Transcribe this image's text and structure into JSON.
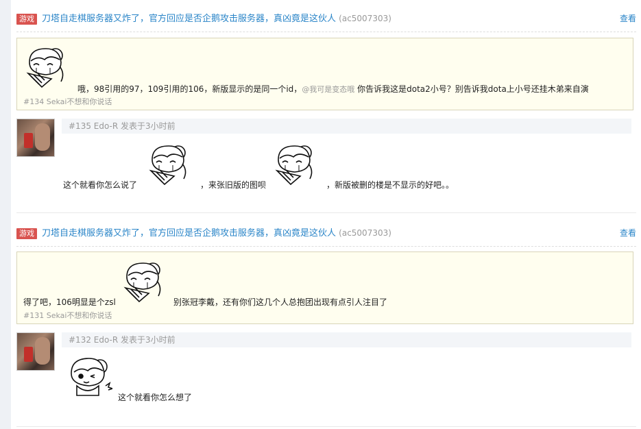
{
  "posts": [
    {
      "tag": "游戏",
      "title": "刀塔自走棋服务器又炸了，官方回应是否企鹅攻击服务器，真凶竟是这伙人",
      "ac": "(ac5007303)",
      "view": "查看",
      "quote": {
        "text_before": "哦，98引用的97，109引用的106，新版显示的是同一个id，",
        "mention": "@我可是变态哦",
        "text_after": " 你告诉我这是dota2小号？别告诉我dota上小号还挂木弟来自演",
        "meta": "#134 Sekai不想和你说话"
      },
      "reply": {
        "meta": "#135 Edo-R 发表于3小时前",
        "seg1": "这个就看你怎么说了",
        "seg2": "，来张旧版的图呗",
        "seg3": "，新版被删的楼是不显示的好吧。。"
      }
    },
    {
      "tag": "游戏",
      "title": "刀塔自走棋服务器又炸了，官方回应是否企鹅攻击服务器，真凶竟是这伙人",
      "ac": "(ac5007303)",
      "view": "查看",
      "quote": {
        "text_before": "得了吧，106明显是个zsl",
        "text_after": "别张冠李戴，还有你们这几个人总抱团出现有点引人注目了",
        "meta": "#131 Sekai不想和你说话"
      },
      "reply": {
        "meta": "#132 Edo-R 发表于3小时前",
        "seg1": "这个就看你怎么想了"
      }
    }
  ]
}
